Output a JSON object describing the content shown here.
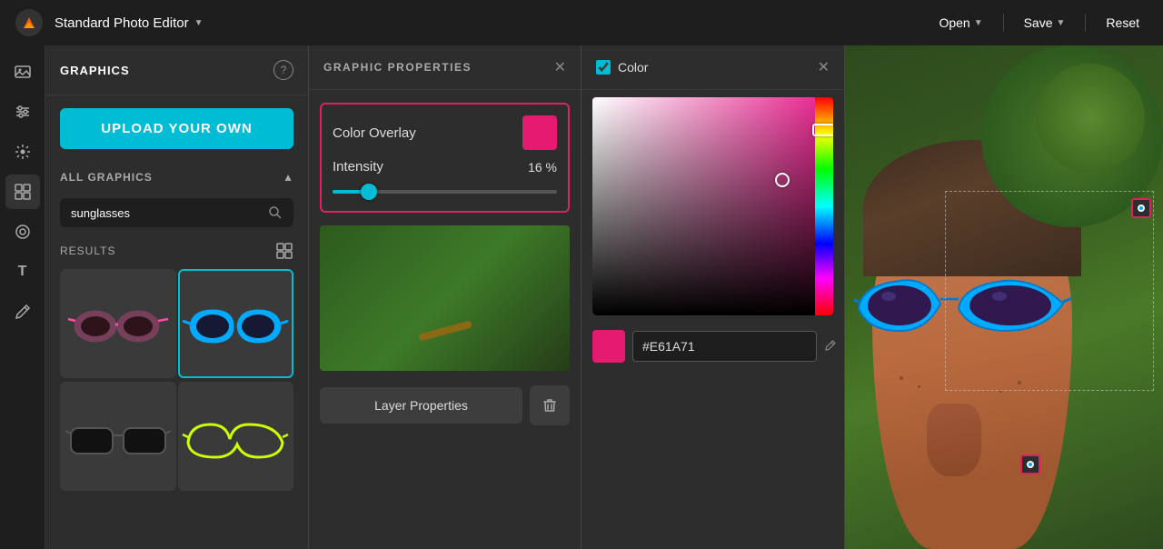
{
  "topbar": {
    "app_title": "Standard Photo Editor",
    "open_label": "Open",
    "save_label": "Save",
    "reset_label": "Reset"
  },
  "graphics_panel": {
    "title": "GRAPHICS",
    "upload_label": "UPLOAD YOUR OWN",
    "all_graphics_label": "ALL GRAPHICS",
    "search_placeholder": "sunglasses",
    "results_label": "Results"
  },
  "properties_panel": {
    "title": "GRAPHIC PROPERTIES",
    "color_overlay_label": "Color Overlay",
    "intensity_label": "Intensity",
    "intensity_value": "16 %",
    "intensity_percent": 16,
    "layer_props_label": "Layer Properties"
  },
  "color_panel": {
    "title": "Color",
    "hex_value": "#E61A71",
    "swatch_color": "#e61a71"
  },
  "icons": {
    "image": "🖼",
    "sliders": "⚙",
    "wand": "✦",
    "grid": "⊞",
    "circle": "◎",
    "text": "T",
    "pencil": "✏"
  }
}
